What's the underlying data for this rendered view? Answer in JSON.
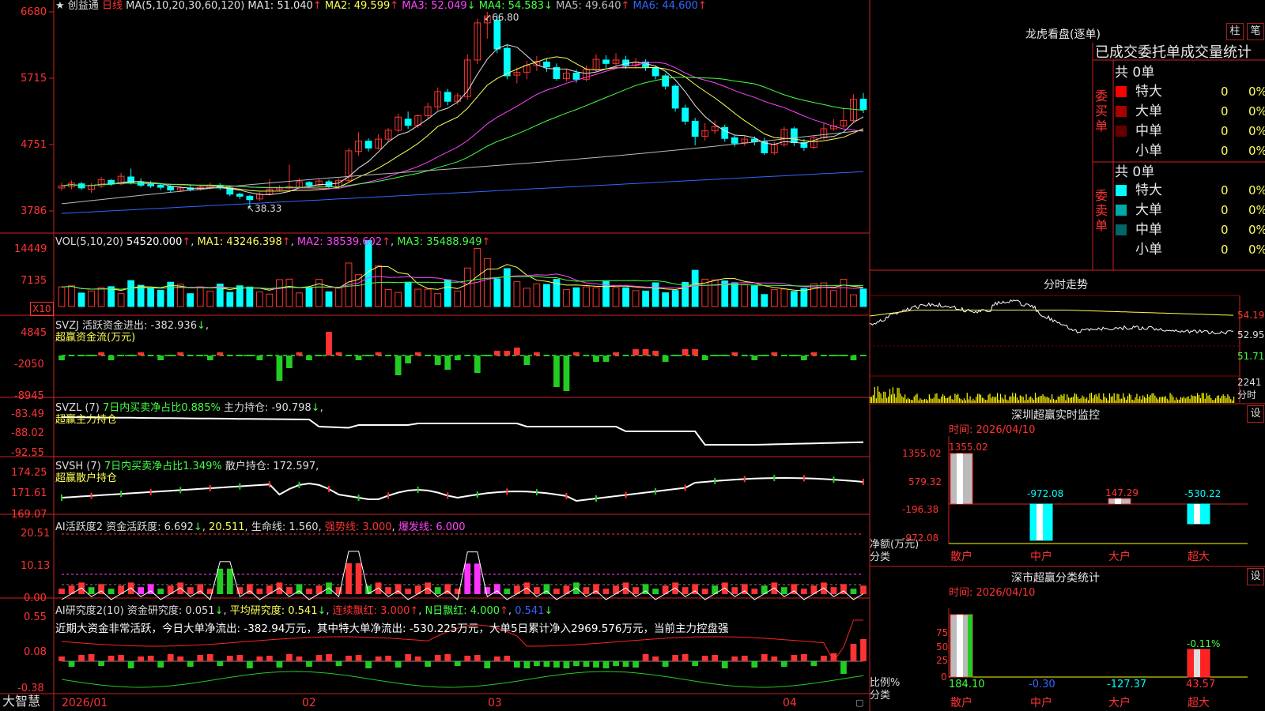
{
  "header": {
    "star": "★",
    "stock_name": "创益通",
    "period": "日线",
    "ma_label": "MA(5,10,20,30,60,120)",
    "ma_values": [
      {
        "label": "MA1:",
        "value": "51.040",
        "arrow": "↑",
        "color": "#e6e6e6"
      },
      {
        "label": "MA2:",
        "value": "49.599",
        "arrow": "↑",
        "color": "#ffff55"
      },
      {
        "label": "MA3:",
        "value": "52.049",
        "arrow": "↓",
        "color": "#ff44ff"
      },
      {
        "label": "MA4:",
        "value": "54.583",
        "arrow": "↓",
        "color": "#44ff44"
      },
      {
        "label": "MA5:",
        "value": "49.640",
        "arrow": "↑",
        "color": "#bbbbbb"
      },
      {
        "label": "MA6:",
        "value": "44.600",
        "arrow": "↑",
        "color": "#3366ff"
      }
    ],
    "high_label": "66.80",
    "low_label": "38.33"
  },
  "volume": {
    "label": "VOL(5,10,20)",
    "value": "54520.000",
    "ma1": "MA1: 43246.398",
    "ma2": "MA2: 38539.602",
    "ma3": "MA3: 35488.949",
    "unit": "X10"
  },
  "svzj": {
    "label": "SVZJ  活跃资金进出: -382.936",
    "sub": "超赢资金流(万元)"
  },
  "svzl": {
    "label": "SVZL (7)",
    "pct": "7日内买卖净占比0.885%",
    "hold": "主力持仓: -90.798",
    "sub": "超赢主力持仓"
  },
  "svsh": {
    "label": "SVSH (7)",
    "pct": "7日内买卖净占比1.349%",
    "hold": "散户持仓: 172.597",
    "sub": "超赢散户持仓"
  },
  "ai1": {
    "label": "AI活跃度2",
    "a": "资金活跃度: 6.692",
    "b": "20.511",
    "c": "生命线: 1.560",
    "d": "强势线: 3.000",
    "e": "爆发线: 6.000"
  },
  "ai2": {
    "label": "AI研究度2(10)",
    "a": "资金研究度: 0.051",
    "b": "平均研究度: 0.541",
    "c": "连续飘红: 3.000",
    "d": "N日飘红: 4.000",
    "e": "0.541",
    "desc": "近期大资金非常活跃，今日大单净流出: -382.94万元，其中特大单净流出: -530.225万元，大单5日累计净入2969.576万元，当前主力控盘强"
  },
  "xaxis": {
    "labels": [
      "2026/01",
      "02",
      "03",
      "04"
    ],
    "brand": "大智慧"
  },
  "yaxis": {
    "main": [
      "6680",
      "5715",
      "4751",
      "3786"
    ],
    "vol": [
      "14449",
      "7135"
    ],
    "svzj": [
      "4845",
      "-2050",
      "-8945"
    ],
    "svzl": [
      "-83.49",
      "-88.02",
      "-92.55"
    ],
    "svsh": [
      "174.25",
      "171.61",
      "169.07"
    ],
    "ai1": [
      "20.51",
      "10.13",
      "0.00"
    ],
    "ai2": [
      "0.55",
      "0.08",
      "-0.38"
    ]
  },
  "right": {
    "lhb_title": "龙虎看盘(逐单)",
    "btn_zhu": "柱",
    "btn_bi": "笔",
    "tabs": "已成交委托单成交量统计",
    "buy_label": "委买单",
    "sell_label": "委卖单",
    "buy_total": "共 0单",
    "sell_total": "共 0单",
    "buy_rows": [
      {
        "name": "特大",
        "count": "0",
        "pct": "0%"
      },
      {
        "name": "大单",
        "count": "0",
        "pct": "0%"
      },
      {
        "name": "中单",
        "count": "0",
        "pct": "0%"
      },
      {
        "name": "小单",
        "count": "0",
        "pct": "0%"
      }
    ],
    "sell_rows": [
      {
        "name": "特大",
        "count": "0",
        "pct": "0%"
      },
      {
        "name": "大单",
        "count": "0",
        "pct": "0%"
      },
      {
        "name": "中单",
        "count": "0",
        "pct": "0%"
      },
      {
        "name": "小单",
        "count": "0",
        "pct": "0%"
      }
    ],
    "fs_title": "分时走势",
    "fs_y": [
      "54.19",
      "52.95",
      "51.71"
    ],
    "fs_vol": "2241",
    "fs_unit": "分时",
    "sz_title": "深圳超赢实时监控",
    "sz_btn": "设",
    "sz_time": "时间: 2026/04/10",
    "sz_y": [
      "1355.02",
      "579.32",
      "-196.38",
      "-972.08"
    ],
    "sz_ylabel": "净额(万元)",
    "sz_xlabel": "分类",
    "sz_values": [
      "1355.02",
      "-972.08",
      "147.29",
      "-530.22"
    ],
    "sz_cats": [
      "散户",
      "中户",
      "大户",
      "超大"
    ],
    "fl_title": "深市超赢分类统计",
    "fl_btn": "设",
    "fl_time": "时间: 2026/04/10",
    "fl_y": [
      "75",
      "50",
      "25",
      "0"
    ],
    "fl_ylabel": "比例%",
    "fl_xlabel": "分类",
    "fl_top_label": "-0.11%",
    "fl_values": [
      "184.10",
      "-0.30",
      "-127.37",
      "43.57"
    ],
    "fl_cats": [
      "散户",
      "中户",
      "大户",
      "超大"
    ]
  },
  "colors": {
    "up": "#ff3333",
    "down": "#00ffff",
    "grid": "#8b0000",
    "axis": "#cc2222"
  },
  "chart_data": {
    "type": "candlestick",
    "candles": [
      [
        41.2,
        41.5,
        40.8,
        42.0
      ],
      [
        41.4,
        41.9,
        41.0,
        42.3
      ],
      [
        41.8,
        41.2,
        40.9,
        42.1
      ],
      [
        41.0,
        41.6,
        40.5,
        41.9
      ],
      [
        41.5,
        42.4,
        41.2,
        42.8
      ],
      [
        42.3,
        41.8,
        41.5,
        42.5
      ],
      [
        41.8,
        42.9,
        41.6,
        43.4
      ],
      [
        42.8,
        42.0,
        41.7,
        44.0
      ],
      [
        42.0,
        41.6,
        41.3,
        42.6
      ],
      [
        41.7,
        41.5,
        41.2,
        42.2
      ],
      [
        41.6,
        41.3,
        40.9,
        41.8
      ],
      [
        41.4,
        40.9,
        40.6,
        41.6
      ],
      [
        40.9,
        41.2,
        40.6,
        41.5
      ],
      [
        41.2,
        41.0,
        40.7,
        41.6
      ],
      [
        41.0,
        41.3,
        40.8,
        41.6
      ],
      [
        41.3,
        41.6,
        41.0,
        42.0
      ],
      [
        41.6,
        41.2,
        40.9,
        41.9
      ],
      [
        41.2,
        40.3,
        40.0,
        41.4
      ],
      [
        40.3,
        40.0,
        39.6,
        40.5
      ],
      [
        40.0,
        39.5,
        38.3,
        40.2
      ],
      [
        39.6,
        40.3,
        39.3,
        40.6
      ],
      [
        40.3,
        41.0,
        40.1,
        42.5
      ],
      [
        41.0,
        41.2,
        40.7,
        41.6
      ],
      [
        41.2,
        41.4,
        40.9,
        44.6
      ],
      [
        41.3,
        42.1,
        41.1,
        42.6
      ],
      [
        42.0,
        41.6,
        41.2,
        42.2
      ],
      [
        41.6,
        42.2,
        41.4,
        42.5
      ],
      [
        42.1,
        41.4,
        41.0,
        42.4
      ],
      [
        41.4,
        42.3,
        41.1,
        42.6
      ],
      [
        42.3,
        46.6,
        42.0,
        47.0
      ],
      [
        46.5,
        48.0,
        45.9,
        49.3
      ],
      [
        48.0,
        47.0,
        46.5,
        48.4
      ],
      [
        47.0,
        48.3,
        46.8,
        49.0
      ],
      [
        48.3,
        49.6,
        47.8,
        49.9
      ],
      [
        49.6,
        51.5,
        49.3,
        52.0
      ],
      [
        51.2,
        50.3,
        49.8,
        52.3
      ],
      [
        50.3,
        51.7,
        49.9,
        51.9
      ],
      [
        51.7,
        53.0,
        51.2,
        53.6
      ],
      [
        53.0,
        55.2,
        52.5,
        55.8
      ],
      [
        55.1,
        53.8,
        53.2,
        55.6
      ],
      [
        53.8,
        54.6,
        53.3,
        55.0
      ],
      [
        54.5,
        59.8,
        54.0,
        60.6
      ],
      [
        59.8,
        65.2,
        59.2,
        65.8
      ],
      [
        65.2,
        66.2,
        62.9,
        66.8
      ],
      [
        65.6,
        61.4,
        60.8,
        66.4
      ],
      [
        61.5,
        57.5,
        57.0,
        62.0
      ],
      [
        57.6,
        58.0,
        56.4,
        58.7
      ],
      [
        58.0,
        59.0,
        57.0,
        59.7
      ],
      [
        59.0,
        59.6,
        58.2,
        60.4
      ],
      [
        59.5,
        58.8,
        58.1,
        60.0
      ],
      [
        58.7,
        57.1,
        56.8,
        59.3
      ],
      [
        57.1,
        57.9,
        56.7,
        58.5
      ],
      [
        57.9,
        57.0,
        56.5,
        58.4
      ],
      [
        57.0,
        58.4,
        56.7,
        59.0
      ],
      [
        58.4,
        59.9,
        58.0,
        60.6
      ],
      [
        59.8,
        59.3,
        58.6,
        60.5
      ],
      [
        59.3,
        59.8,
        58.9,
        60.8
      ],
      [
        59.8,
        59.0,
        58.5,
        60.4
      ],
      [
        59.0,
        59.5,
        58.6,
        60.1
      ],
      [
        59.5,
        58.8,
        58.2,
        59.9
      ],
      [
        58.7,
        57.5,
        57.0,
        59.0
      ],
      [
        57.5,
        56.0,
        55.5,
        57.8
      ],
      [
        56.0,
        52.8,
        52.3,
        56.3
      ],
      [
        52.8,
        50.9,
        50.4,
        53.3
      ],
      [
        50.9,
        48.7,
        47.4,
        51.4
      ],
      [
        48.7,
        49.5,
        48.1,
        50.6
      ],
      [
        49.5,
        50.1,
        49.0,
        51.0
      ],
      [
        50.0,
        48.4,
        47.9,
        50.4
      ],
      [
        48.5,
        47.7,
        47.2,
        48.9
      ],
      [
        47.8,
        48.3,
        47.3,
        48.8
      ],
      [
        48.3,
        47.9,
        47.4,
        48.7
      ],
      [
        47.9,
        46.3,
        46.0,
        48.5
      ],
      [
        46.3,
        47.5,
        46.0,
        47.9
      ],
      [
        47.5,
        49.7,
        47.2,
        50.1
      ],
      [
        49.8,
        47.8,
        47.3,
        50.1
      ],
      [
        47.8,
        47.1,
        46.6,
        48.3
      ],
      [
        47.1,
        48.5,
        46.8,
        48.9
      ],
      [
        48.5,
        49.8,
        48.2,
        50.7
      ],
      [
        49.8,
        50.2,
        49.5,
        51.2
      ],
      [
        50.2,
        51.0,
        49.9,
        52.9
      ],
      [
        51.0,
        54.1,
        50.7,
        54.8
      ],
      [
        54.1,
        52.6,
        52.1,
        55.0
      ]
    ]
  }
}
